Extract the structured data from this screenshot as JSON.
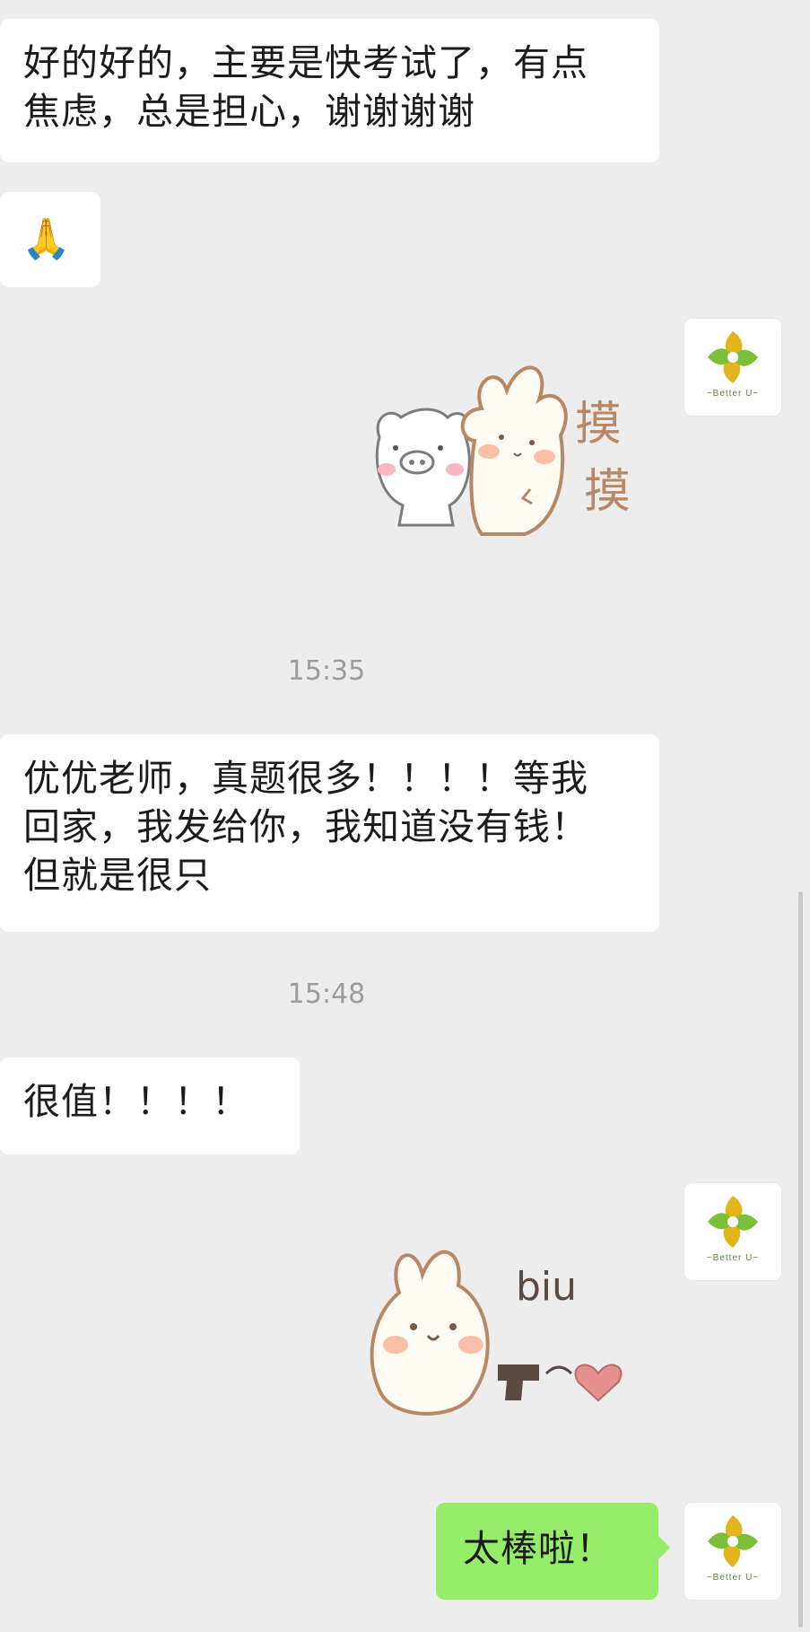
{
  "messages": [
    {
      "direction": "incoming",
      "type": "text",
      "lines": [
        "好的好的，主要是快考试了，有点",
        "焦虑，总是担心，谢谢谢谢"
      ]
    },
    {
      "direction": "incoming",
      "type": "emoji",
      "text": "🙏"
    },
    {
      "direction": "outgoing",
      "type": "sticker",
      "sticker_text": "摸摸",
      "icon": "pig-and-bunny-pat-sticker"
    },
    {
      "type": "timestamp",
      "text": "15:35"
    },
    {
      "direction": "incoming",
      "type": "text",
      "lines": [
        "优优老师，真题很多！！！！等我",
        "回家，我发给你，我知道没有钱！",
        "但就是很只"
      ]
    },
    {
      "type": "timestamp",
      "text": "15:48"
    },
    {
      "direction": "incoming",
      "type": "text",
      "lines": [
        "很值！！！！"
      ]
    },
    {
      "direction": "outgoing",
      "type": "sticker",
      "sticker_text": "biu",
      "icon": "bunny-heart-gun-sticker"
    },
    {
      "direction": "outgoing",
      "type": "text",
      "lines": [
        "太棒啦！"
      ]
    }
  ],
  "avatar": {
    "brand": "~Better U~",
    "icon": "better-u-logo"
  },
  "colors": {
    "background": "#ededed",
    "incoming_bubble": "#ffffff",
    "outgoing_bubble": "#95ec69",
    "timestamp": "#9c9c9c"
  }
}
